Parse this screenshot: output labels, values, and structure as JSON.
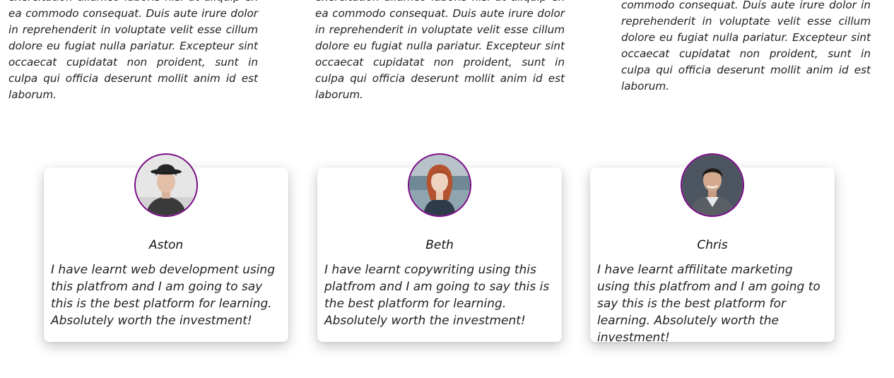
{
  "intro": {
    "paragraphs": [
      "exercitation ullamco laboris nisi ut aliquip ex ea commodo consequat. Duis aute irure dolor in reprehenderit in voluptate velit esse cillum dolore eu fugiat nulla pariatur. Excepteur sint occaecat cupidatat non proident, sunt in culpa qui officia deserunt mollit anim id est laborum.",
      "exercitation ullamco laboris nisi ut aliquip ex ea commodo consequat. Duis aute irure dolor in reprehenderit in voluptate velit esse cillum dolore eu fugiat nulla pariatur. Excepteur sint occaecat cupidatat non proident, sunt in culpa qui officia deserunt mollit anim id est laborum.",
      "commodo consequat. Duis aute irure dolor in reprehenderit in voluptate velit esse cillum dolore eu fugiat nulla pariatur. Excepteur sint occaecat cupidatat non proident, sunt in culpa qui officia deserunt mollit anim id est laborum."
    ]
  },
  "testimonials": [
    {
      "name": "Aston",
      "quote": "I have learnt web development using this platfrom and I am going to say this is the best platform for learning. Absolutely worth the investment!"
    },
    {
      "name": "Beth",
      "quote": "I have learnt copywriting using this platfrom and I am going to say this is the best platform for learning. Absolutely worth the investment!"
    },
    {
      "name": "Chris",
      "quote": "I have learnt affilitate marketing using this platfrom and I am going to say this is the best platform for learning. Absolutely worth the investment!"
    }
  ],
  "colors": {
    "avatar_border": "#7a0a87",
    "card_background": "#ffffff",
    "text": "#222222"
  }
}
